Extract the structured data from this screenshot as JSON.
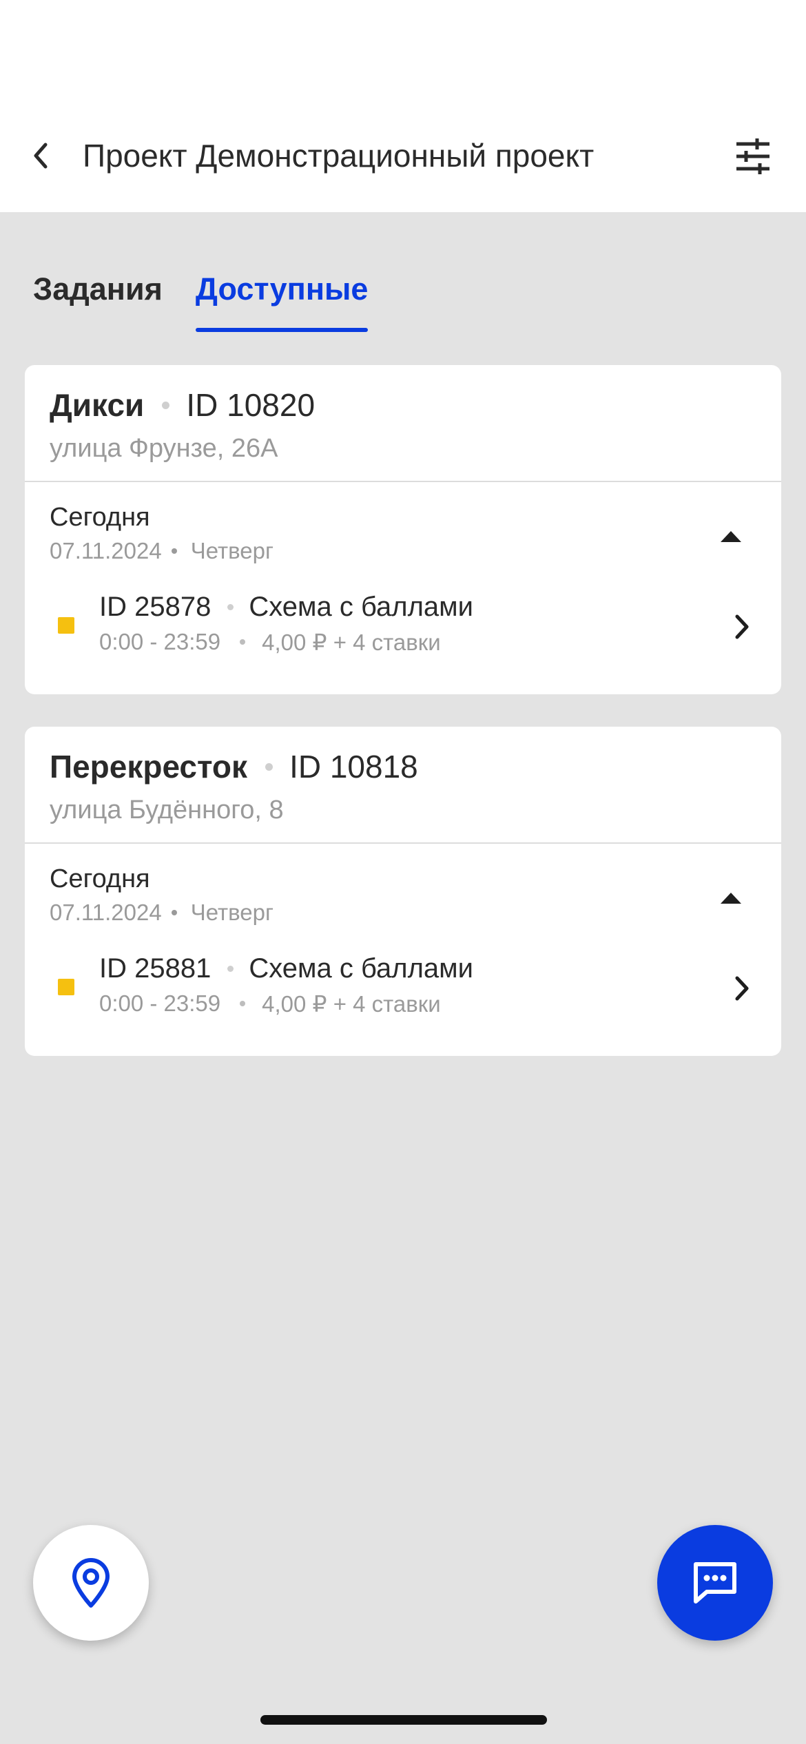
{
  "header": {
    "title": "Проект Демонстрационный проект",
    "back_icon": "chevron-left-icon",
    "filter_icon": "sliders-icon"
  },
  "tabs": [
    {
      "label": "Задания",
      "active": false
    },
    {
      "label": "Доступные",
      "active": true
    }
  ],
  "colors": {
    "accent": "#0a3ce0",
    "task_marker": "#f5c010",
    "background": "#e3e3e3"
  },
  "cards": [
    {
      "store_name": "Дикси",
      "store_id": "ID 10820",
      "address": "улица Фрунзе, 26А",
      "day_label": "Сегодня",
      "date": "07.11.2024",
      "weekday": "Четверг",
      "task": {
        "id": "ID 25878",
        "scheme": "Схема с баллами",
        "time": "0:00 - 23:59",
        "price": "4,00 ₽ + 4 ставки"
      }
    },
    {
      "store_name": "Перекресток",
      "store_id": "ID 10818",
      "address": "улица Будённого, 8",
      "day_label": "Сегодня",
      "date": "07.11.2024",
      "weekday": "Четверг",
      "task": {
        "id": "ID 25881",
        "scheme": "Схема с баллами",
        "time": "0:00 - 23:59",
        "price": "4,00 ₽ + 4 ставки"
      }
    }
  ],
  "fabs": {
    "map_icon": "map-pin-icon",
    "chat_icon": "chat-icon"
  }
}
